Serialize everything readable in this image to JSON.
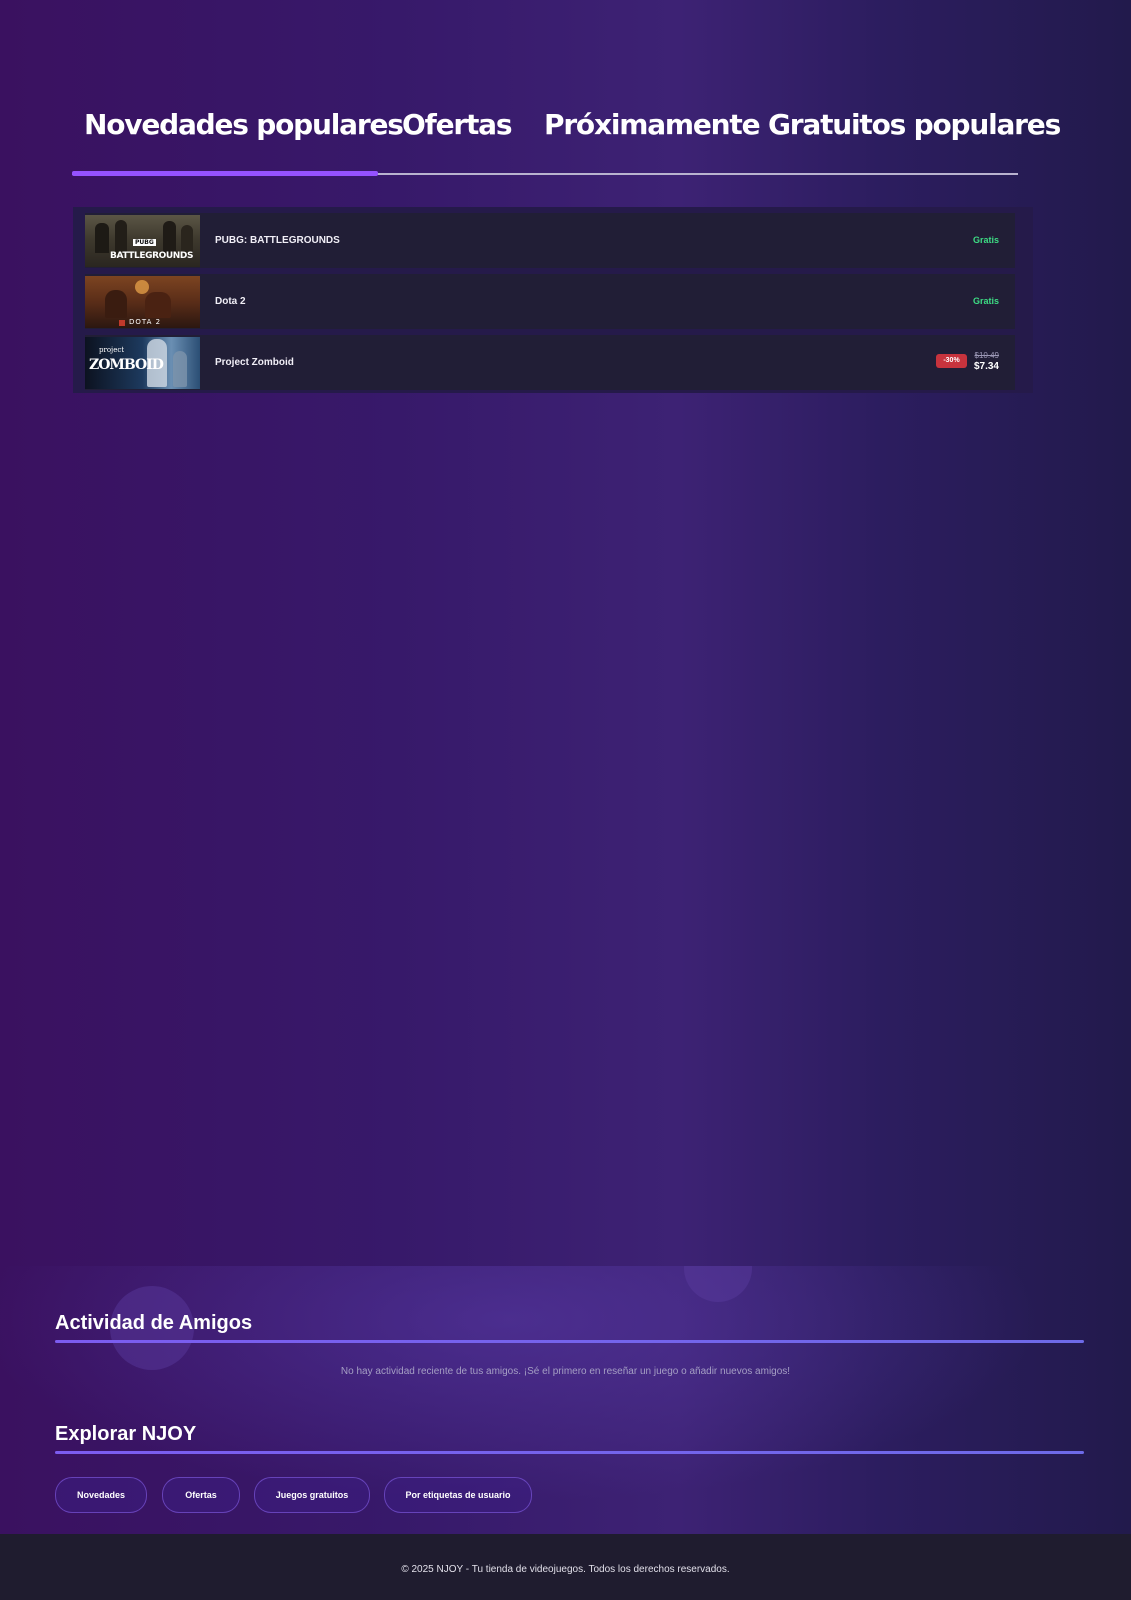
{
  "tabs": [
    {
      "label": "Novedades populares",
      "active": true
    },
    {
      "label": "Ofertas",
      "active": false
    },
    {
      "label": "Próximamente",
      "active": false
    },
    {
      "label": "Gratuitos populares",
      "active": false
    }
  ],
  "games": [
    {
      "name": "PUBG: BATTLEGROUNDS",
      "thumb_text": "BATTLEGROUNDS",
      "thumb_badge": "PUBG",
      "price": "Gratis"
    },
    {
      "name": "Dota 2",
      "thumb_text": "DOTA 2",
      "price": "Gratis"
    },
    {
      "name": "Project Zomboid",
      "thumb_small": "project",
      "thumb_text": "ZOMBOID",
      "discount": "-30%",
      "old_price": "$10.49",
      "new_price": "$7.34"
    }
  ],
  "friends": {
    "title": "Actividad de Amigos",
    "empty_message": "No hay actividad reciente de tus amigos. ¡Sé el primero en reseñar un juego o añadir nuevos amigos!"
  },
  "explore": {
    "title": "Explorar NJOY",
    "links": [
      "Novedades",
      "Ofertas",
      "Juegos gratuitos",
      "Por etiquetas de usuario"
    ]
  },
  "footer": {
    "copyright": "© 2025 NJOY - Tu tienda de videojuegos. Todos los derechos reservados."
  },
  "colors": {
    "accent": "#9552ff",
    "free_price": "#3ddc84",
    "discount_badge": "#c7333d",
    "row_bg": "#211e36",
    "footer_bg": "#1f1c2f"
  }
}
